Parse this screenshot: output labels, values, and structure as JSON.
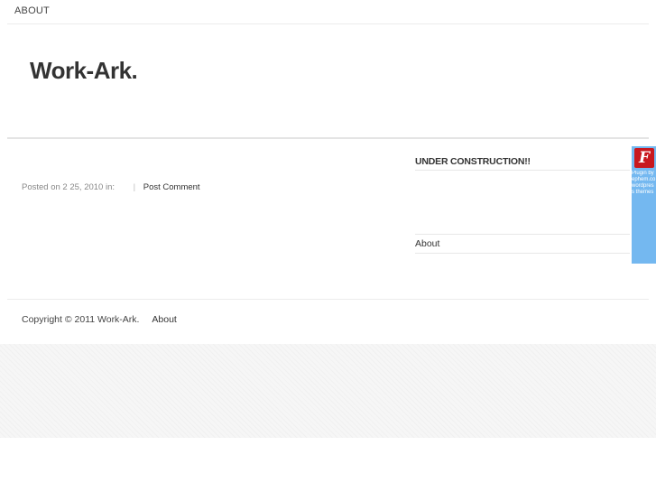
{
  "nav": {
    "about_label": "ABOUT"
  },
  "header": {
    "site_title": "Work-Ark."
  },
  "post": {
    "meta_prefix": "Posted on 2  25, 2010 in:",
    "separator": "|",
    "comment_link": "Post Comment"
  },
  "sidebar": {
    "widget_title": "UNDER CONSTRUCTION!!",
    "link_about": "About"
  },
  "flash_badge": {
    "icon_letter": "F",
    "text": "Plugin by ephem.co wordpress themes",
    "colors": {
      "background": "#74b8f0",
      "icon": "#c8181e"
    }
  },
  "footer": {
    "copyright": "Copyright © 2011 Work-Ark.",
    "about_link": "About"
  }
}
